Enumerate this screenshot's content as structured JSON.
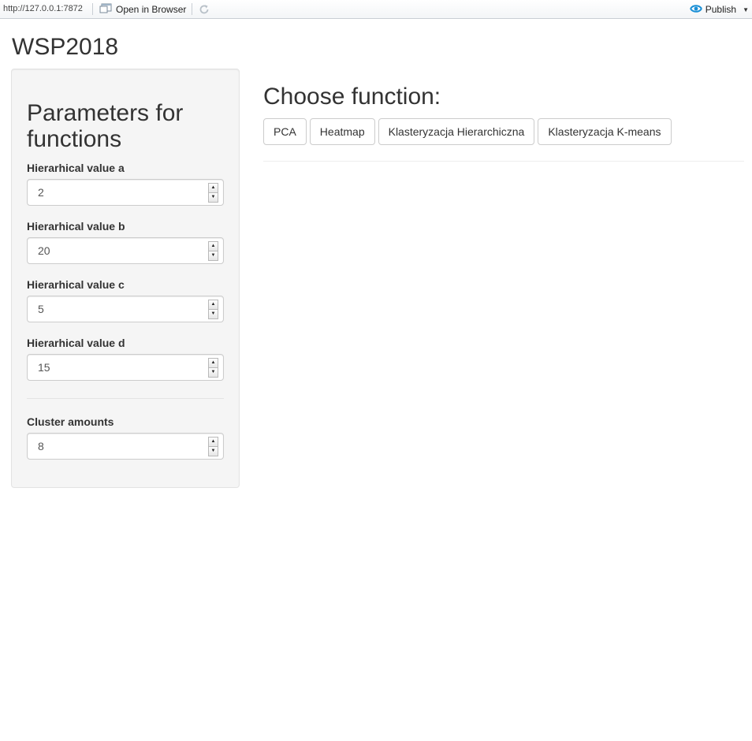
{
  "toolbar": {
    "url": "http://127.0.0.1:7872",
    "open_in_browser_label": "Open in Browser",
    "publish_label": "Publish",
    "icons": {
      "open_browser": "open-browser-icon",
      "refresh": "refresh-icon",
      "publish": "publish-icon",
      "publish_dropdown": "caret-down-icon"
    }
  },
  "page": {
    "title": "WSP2018"
  },
  "sidebar": {
    "title": "Parameters for functions",
    "fields": [
      {
        "label": "Hierarhical value a",
        "value": "2"
      },
      {
        "label": "Hierarhical value b",
        "value": "20"
      },
      {
        "label": "Hierarhical value c",
        "value": "5"
      },
      {
        "label": "Hierarhical value d",
        "value": "15"
      },
      {
        "label": "Cluster amounts",
        "value": "8"
      }
    ]
  },
  "main": {
    "heading": "Choose function:",
    "buttons": [
      "PCA",
      "Heatmap",
      "Klasteryzacja Hierarchiczna",
      "Klasteryzacja K-means"
    ]
  },
  "colors": {
    "sidebar_bg": "#f5f5f5",
    "border": "#cccccc",
    "publish_accent": "#1a8fd6"
  }
}
